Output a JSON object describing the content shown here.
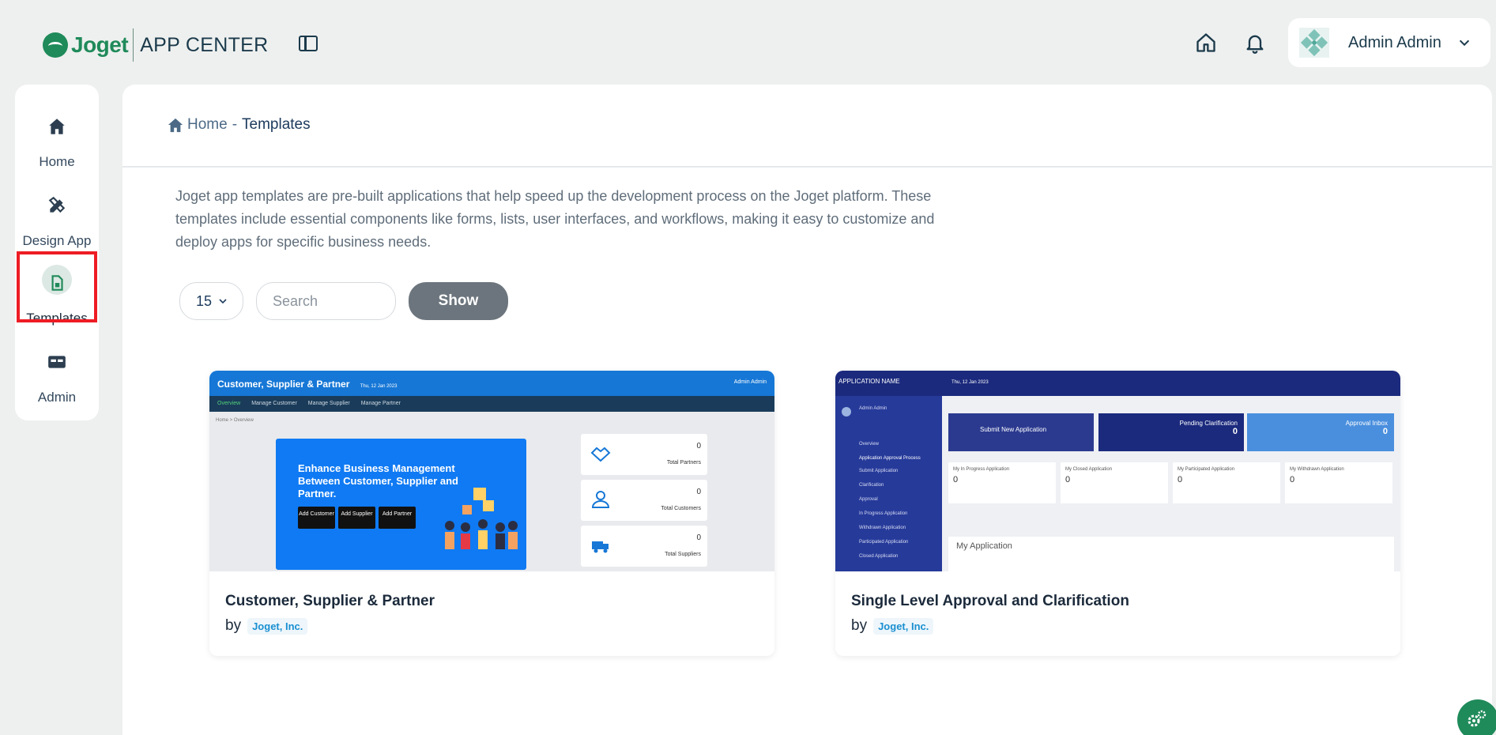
{
  "header": {
    "logo_text": "Joget",
    "app_title": "APP CENTER",
    "user_name": "Admin Admin"
  },
  "sidebar": {
    "items": [
      {
        "label": "Home",
        "icon": "home-icon"
      },
      {
        "label": "Design App",
        "icon": "design-tools-icon"
      },
      {
        "label": "Templates",
        "icon": "template-file-icon",
        "active": true
      },
      {
        "label": "Admin",
        "icon": "admin-card-icon"
      }
    ]
  },
  "breadcrumb": {
    "home": "Home",
    "separator": "-",
    "current": "Templates"
  },
  "description": "Joget app templates are pre-built applications that help speed up the development process on the Joget platform. These templates include essential components like forms, lists, user interfaces, and workflows, making it easy to customize and deploy apps for specific business needs.",
  "controls": {
    "page_size": "15",
    "search_placeholder": "Search",
    "show_label": "Show"
  },
  "templates": [
    {
      "title": "Customer, Supplier & Partner",
      "by": "by",
      "author": "Joget, Inc.",
      "preview": {
        "app_name": "Customer, Supplier & Partner",
        "date": "Thu, 12 Jan 2023",
        "user": "Admin Admin",
        "tabs": [
          "Overview",
          "Manage Customer",
          "Manage Supplier",
          "Manage Partner"
        ],
        "crumb": "Home > Overview",
        "banner": "Enhance Business Management Between Customer, Supplier and Partner.",
        "buttons": [
          "Add Customer",
          "Add Supplier",
          "Add Partner"
        ],
        "stats": [
          {
            "value": "0",
            "label": "Total Partners"
          },
          {
            "value": "0",
            "label": "Total Customers"
          },
          {
            "value": "0",
            "label": "Total Suppliers"
          }
        ]
      }
    },
    {
      "title": "Single Level Approval and Clarification",
      "by": "by",
      "author": "Joget, Inc.",
      "preview": {
        "app_name": "APPLICATION NAME",
        "date": "Thu, 12 Jan 2023",
        "user": "Admin Admin",
        "menu": [
          "Overview",
          "Application Approval Process",
          "Submit Application",
          "Clarification",
          "Approval",
          "In Progress Application",
          "Withdrawn Application",
          "Participated Application",
          "Closed Application"
        ],
        "cards": [
          {
            "label": "Submit New Application"
          },
          {
            "label": "Pending Clarification",
            "value": "0"
          },
          {
            "label": "Approval Inbox",
            "value": "0"
          }
        ],
        "stats": [
          {
            "label": "My In Progress Application",
            "value": "0"
          },
          {
            "label": "My Closed Application",
            "value": "0"
          },
          {
            "label": "My Participated Application",
            "value": "0"
          },
          {
            "label": "My Withdrawn Application",
            "value": "0"
          }
        ],
        "section": "My Application"
      }
    }
  ],
  "colors": {
    "brand": "#1f8a5a",
    "highlight": "#ee1c24",
    "show_button": "#6c757d",
    "author_link": "#1a8fd1"
  }
}
